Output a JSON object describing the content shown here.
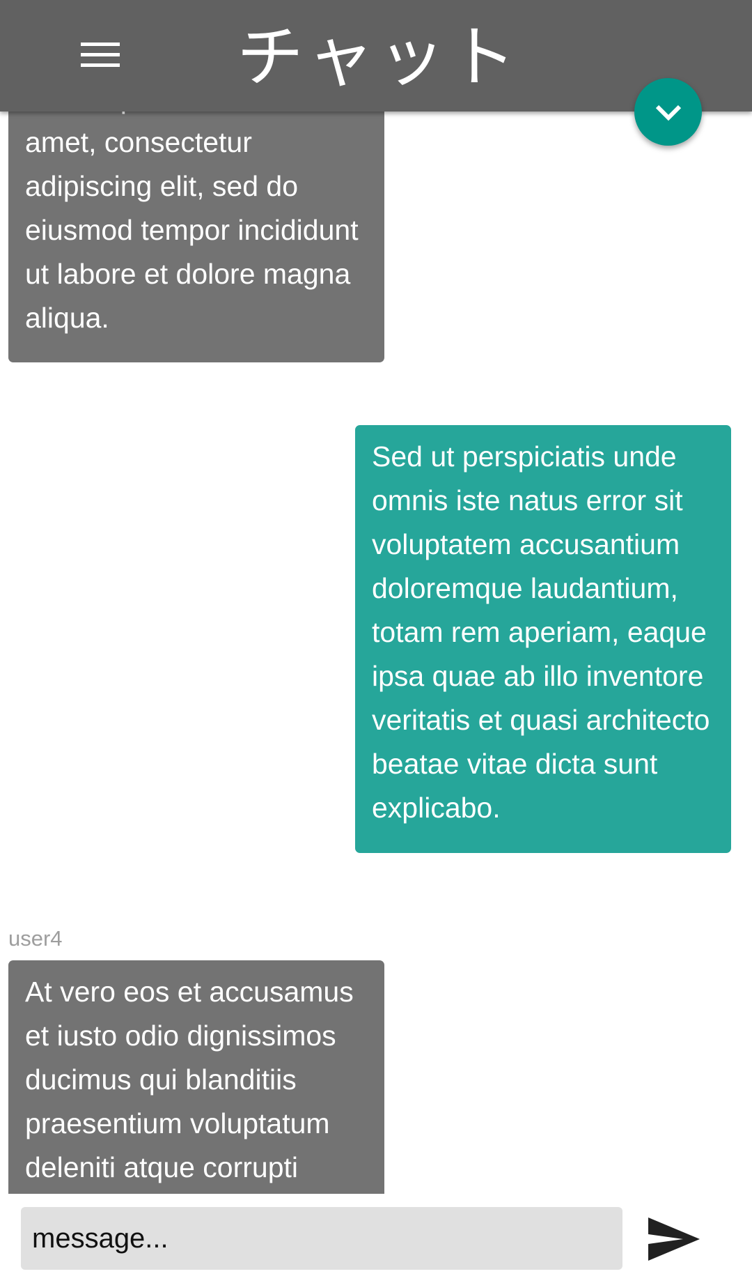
{
  "header": {
    "title": "チャット",
    "menu_icon": "hamburger-menu-icon"
  },
  "scroll_button": {
    "icon": "chevron-down-icon",
    "color": "#009688"
  },
  "colors": {
    "header_bg": "#616161",
    "received_bubble": "#737373",
    "sent_bubble": "#26a69a",
    "sender_name": "#9e9e9e",
    "input_bg": "#e0e0e0"
  },
  "messages": [
    {
      "direction": "received",
      "sender": "",
      "text": "Lorem ipsum dolor sit amet, consectetur adipiscing elit, sed do eiusmod tempor incididunt ut labore et dolore magna aliqua."
    },
    {
      "direction": "sent",
      "sender": "",
      "text": "Sed ut perspiciatis unde omnis iste natus error sit voluptatem accusantium doloremque laudantium, totam rem aperiam, eaque ipsa quae ab illo inventore veritatis et quasi architecto beatae vitae dicta sunt explicabo."
    },
    {
      "direction": "received",
      "sender": "user4",
      "text": "At vero eos et accusamus et iusto odio dignissimos ducimus qui blanditiis praesentium voluptatum deleniti atque corrupti"
    }
  ],
  "composer": {
    "placeholder": "message...",
    "value": "",
    "send_icon": "send-icon"
  }
}
